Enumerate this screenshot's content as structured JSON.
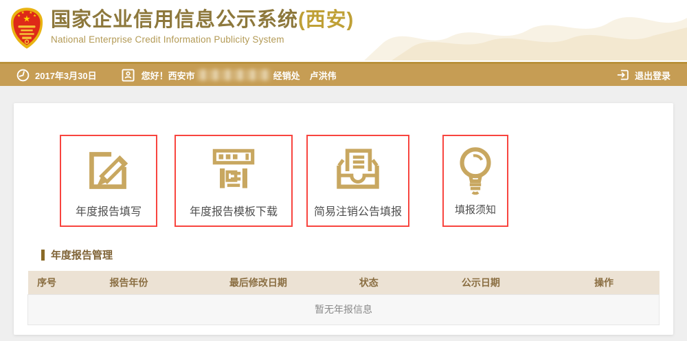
{
  "header": {
    "title": "国家企业信用信息公示系统",
    "title_suffix": "(西安)",
    "subtitle": "National Enterprise Credit Information Publicity System"
  },
  "infobar": {
    "date": "2017年3月30日",
    "greeting_prefix": "您好！西安市",
    "greeting_redacted": true,
    "greeting_suffix": "经销处",
    "user_name": "卢洪伟",
    "logout_label": "退出登录"
  },
  "shortcuts": [
    {
      "label": "年度报告填写",
      "icon": "edit-square-icon"
    },
    {
      "label": "年度报告模板下载",
      "icon": "template-list-icon"
    },
    {
      "label": "简易注销公告填报",
      "icon": "inbox-document-icon"
    },
    {
      "label": "填报须知",
      "icon": "lightbulb-icon"
    }
  ],
  "report_section": {
    "title": "年度报告管理",
    "columns": [
      "序号",
      "报告年份",
      "最后修改日期",
      "状态",
      "公示日期",
      "操作"
    ],
    "empty_message": "暂无年报信息"
  },
  "colors": {
    "title_gold": "#8d783c",
    "suffix_gold": "#bfa036",
    "bar_gold": "#c69d54",
    "icon_gold": "#c8a760",
    "highlight_red": "#f8443e",
    "table_header_bg": "#ece2d4",
    "table_header_text": "#8a6e42"
  }
}
